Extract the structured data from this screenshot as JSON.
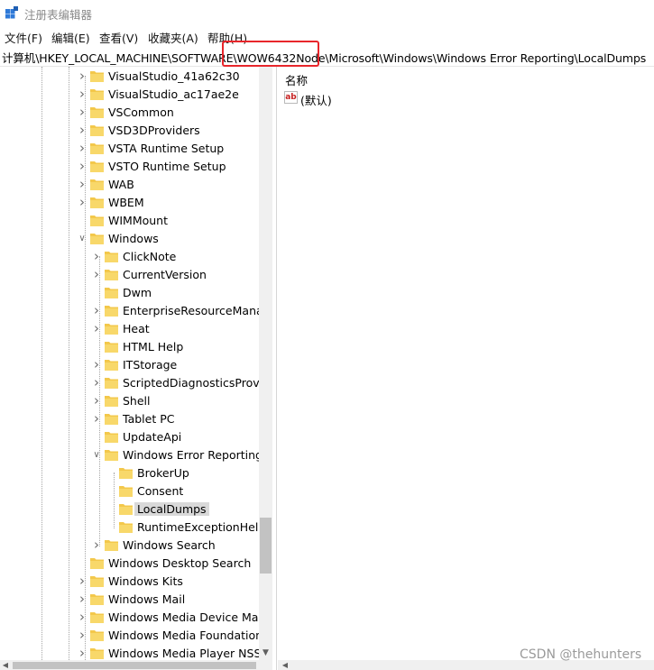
{
  "window": {
    "title": "注册表编辑器",
    "icon": "regedit-icon"
  },
  "menu": [
    {
      "label": "文件(F)"
    },
    {
      "label": "编辑(E)"
    },
    {
      "label": "查看(V)"
    },
    {
      "label": "收藏夹(A)"
    },
    {
      "label": "帮助(H)"
    }
  ],
  "address": {
    "path": "计算机\\HKEY_LOCAL_MACHINE\\SOFTWARE\\WOW6432Node\\Microsoft\\Windows\\Windows Error Reporting\\LocalDumps"
  },
  "tree": [
    {
      "label": "VisualStudio_41a62c30",
      "level": 0,
      "state": "collapsed"
    },
    {
      "label": "VisualStudio_ac17ae2e",
      "level": 0,
      "state": "collapsed"
    },
    {
      "label": "VSCommon",
      "level": 0,
      "state": "collapsed"
    },
    {
      "label": "VSD3DProviders",
      "level": 0,
      "state": "collapsed"
    },
    {
      "label": "VSTA Runtime Setup",
      "level": 0,
      "state": "collapsed"
    },
    {
      "label": "VSTO Runtime Setup",
      "level": 0,
      "state": "collapsed"
    },
    {
      "label": "WAB",
      "level": 0,
      "state": "collapsed"
    },
    {
      "label": "WBEM",
      "level": 0,
      "state": "collapsed"
    },
    {
      "label": "WIMMount",
      "level": 0,
      "state": "leaf"
    },
    {
      "label": "Windows",
      "level": 0,
      "state": "expanded"
    },
    {
      "label": "ClickNote",
      "level": 1,
      "state": "collapsed"
    },
    {
      "label": "CurrentVersion",
      "level": 1,
      "state": "collapsed"
    },
    {
      "label": "Dwm",
      "level": 1,
      "state": "leaf"
    },
    {
      "label": "EnterpriseResourceManag",
      "level": 1,
      "state": "collapsed"
    },
    {
      "label": "Heat",
      "level": 1,
      "state": "collapsed"
    },
    {
      "label": "HTML Help",
      "level": 1,
      "state": "leaf"
    },
    {
      "label": "ITStorage",
      "level": 1,
      "state": "collapsed"
    },
    {
      "label": "ScriptedDiagnosticsProvid",
      "level": 1,
      "state": "collapsed"
    },
    {
      "label": "Shell",
      "level": 1,
      "state": "collapsed"
    },
    {
      "label": "Tablet PC",
      "level": 1,
      "state": "collapsed"
    },
    {
      "label": "UpdateApi",
      "level": 1,
      "state": "leaf"
    },
    {
      "label": "Windows Error Reporting",
      "level": 1,
      "state": "expanded"
    },
    {
      "label": "BrokerUp",
      "level": 2,
      "state": "leaf"
    },
    {
      "label": "Consent",
      "level": 2,
      "state": "leaf"
    },
    {
      "label": "LocalDumps",
      "level": 2,
      "state": "leaf",
      "selected": true
    },
    {
      "label": "RuntimeExceptionHelpe",
      "level": 2,
      "state": "leaf"
    },
    {
      "label": "Windows Search",
      "level": 1,
      "state": "collapsed"
    },
    {
      "label": "Windows Desktop Search",
      "level": 0,
      "state": "leaf"
    },
    {
      "label": "Windows Kits",
      "level": 0,
      "state": "collapsed"
    },
    {
      "label": "Windows Mail",
      "level": 0,
      "state": "collapsed"
    },
    {
      "label": "Windows Media Device Man",
      "level": 0,
      "state": "collapsed"
    },
    {
      "label": "Windows Media Foundation",
      "level": 0,
      "state": "collapsed"
    },
    {
      "label": "Windows Media Player NSS",
      "level": 0,
      "state": "collapsed"
    }
  ],
  "values_pane": {
    "column_name": "名称",
    "rows": [
      {
        "icon": "string-value-icon",
        "icon_text": "ab",
        "name": "(默认)"
      }
    ]
  },
  "watermark": "CSDN @thehunters",
  "colors": {
    "highlight_box": "#e8262b",
    "folder": "#f3c84b",
    "selection": "#d9d9d9"
  }
}
